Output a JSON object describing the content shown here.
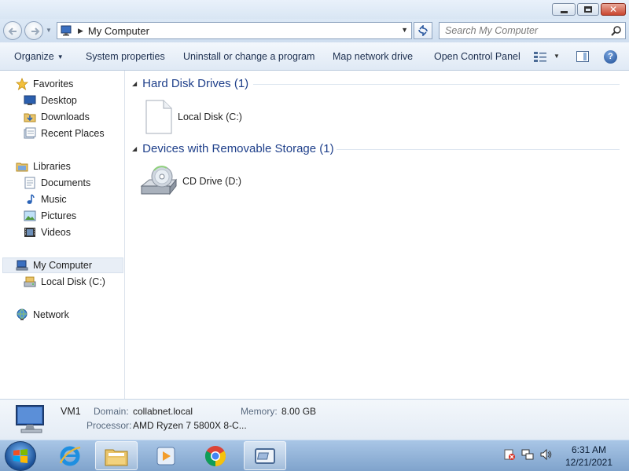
{
  "window": {
    "controls": [
      "minimize-icon",
      "maximize-icon",
      "close-icon"
    ]
  },
  "address": {
    "path": "My Computer",
    "search_placeholder": "Search My Computer"
  },
  "toolbar": {
    "organize": "Organize",
    "system_properties": "System properties",
    "uninstall": "Uninstall or change a program",
    "map_drive": "Map network drive",
    "control_panel": "Open Control Panel"
  },
  "nav": {
    "favorites": "Favorites",
    "desktop": "Desktop",
    "downloads": "Downloads",
    "recent": "Recent Places",
    "libraries": "Libraries",
    "documents": "Documents",
    "music": "Music",
    "pictures": "Pictures",
    "videos": "Videos",
    "computer": "My Computer",
    "local_disk": "Local Disk (C:)",
    "network": "Network"
  },
  "content": {
    "hdd_group": "Hard Disk Drives (1)",
    "hdd_item": "Local Disk (C:)",
    "removable_group": "Devices with Removable Storage (1)",
    "cd_item": "CD Drive (D:)"
  },
  "details": {
    "name": "VM1",
    "domain_label": "Domain:",
    "domain_value": "collabnet.local",
    "memory_label": "Memory:",
    "memory_value": "8.00 GB",
    "processor_label": "Processor:",
    "processor_value": "AMD Ryzen 7 5800X 8-C..."
  },
  "taskbar": {
    "apps": [
      "start-orb-icon",
      "internet-explorer-icon",
      "windows-explorer-icon",
      "media-player-icon",
      "chrome-icon",
      "virtual-machine-icon"
    ],
    "time": "6:31 AM",
    "date": "12/21/2021"
  },
  "colors": {
    "group_header": "#1e3f8a",
    "taskbar": "#8fb0d6",
    "toolbar": "#e6eef8"
  }
}
